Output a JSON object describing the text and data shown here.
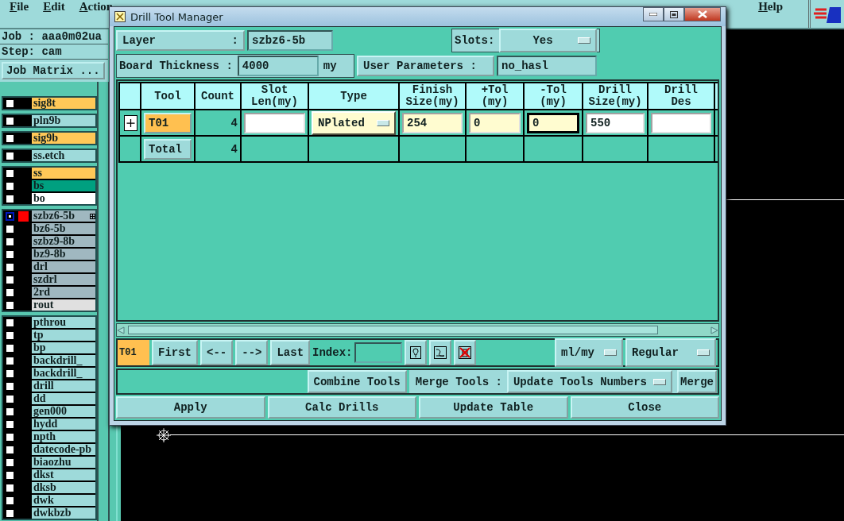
{
  "menu": [
    {
      "label": "File"
    },
    {
      "label": "Edit"
    },
    {
      "label": "Action"
    }
  ],
  "help": "Help",
  "job_info": {
    "job": "Job : aaa0m02ua",
    "step": "Step: cam",
    "matrix_button": "Job Matrix ..."
  },
  "layer_groups": [
    {
      "items": [
        {
          "name": "sig8t",
          "color": "#ffc858",
          "selected": false
        }
      ]
    },
    {
      "items": [
        {
          "name": "pln9b",
          "color": "#9edada",
          "selected": false
        }
      ]
    },
    {
      "items": [
        {
          "name": "sig9b",
          "color": "#ffc858",
          "selected": false
        }
      ]
    },
    {
      "items": [
        {
          "name": "ss.etch",
          "color": "#9edada",
          "selected": false
        }
      ]
    },
    {
      "items": [
        {
          "name": "ss",
          "color": "#ffc858",
          "selected": false
        },
        {
          "name": "bs",
          "color": "#00a080",
          "selected": false
        },
        {
          "name": "bo",
          "color": "#ffffff",
          "selected": false
        }
      ]
    },
    {
      "items": [
        {
          "name": "szbz6-5b",
          "color": "#a0b8c0",
          "selected": true
        },
        {
          "name": "bz6-5b",
          "color": "#a0b8c0",
          "selected": false
        },
        {
          "name": "szbz9-8b",
          "color": "#a0b8c0",
          "selected": false
        },
        {
          "name": "bz9-8b",
          "color": "#a0b8c0",
          "selected": false
        },
        {
          "name": "drl",
          "color": "#a0b8c0",
          "selected": false
        },
        {
          "name": "szdrl",
          "color": "#a0b8c0",
          "selected": false
        },
        {
          "name": "2rd",
          "color": "#a0b8c0",
          "selected": false
        },
        {
          "name": "rout",
          "color": "#e0e0e0",
          "selected": false
        }
      ]
    },
    {
      "items": [
        {
          "name": "pthrou",
          "color": "#9edada",
          "selected": false
        },
        {
          "name": "tp",
          "color": "#9edada",
          "selected": false
        },
        {
          "name": "bp",
          "color": "#9edada",
          "selected": false
        },
        {
          "name": "backdrill_",
          "color": "#9edada",
          "selected": false
        },
        {
          "name": "backdrill_",
          "color": "#9edada",
          "selected": false
        },
        {
          "name": "drill",
          "color": "#9edada",
          "selected": false
        },
        {
          "name": "dd",
          "color": "#9edada",
          "selected": false
        },
        {
          "name": "gen000",
          "color": "#9edada",
          "selected": false
        },
        {
          "name": "hydd",
          "color": "#9edada",
          "selected": false
        },
        {
          "name": "npth",
          "color": "#9edada",
          "selected": false
        },
        {
          "name": "datecode-pb",
          "color": "#9edada",
          "selected": false
        },
        {
          "name": "biaozhu",
          "color": "#9edada",
          "selected": false
        },
        {
          "name": "dkst",
          "color": "#9edada",
          "selected": false
        },
        {
          "name": "dksb",
          "color": "#9edada",
          "selected": false
        },
        {
          "name": "dwk",
          "color": "#9edada",
          "selected": false
        },
        {
          "name": "dwkbzb",
          "color": "#9edada",
          "selected": false
        }
      ]
    }
  ],
  "dialog": {
    "title": "Drill Tool Manager",
    "layer_label": "Layer",
    "layer_colon": ":",
    "layer_value": "szbz6-5b",
    "slots_label": "Slots:",
    "slots_value": "Yes",
    "thickness_label": "Board Thickness :",
    "thickness_value": "4000",
    "thickness_unit": "my",
    "user_params_label": "User Parameters :",
    "user_params_value": "no_hasl",
    "table": {
      "columns": [
        "Tool",
        "Count",
        "Slot\nLen(my)",
        "Type",
        "Finish\nSize(my)",
        "+Tol\n(my)",
        "-Tol\n(my)",
        "Drill\nSize(my)",
        "Drill\nDes"
      ],
      "rows": [
        {
          "expandable": true,
          "cells": [
            {
              "kind": "tool_button",
              "text": "T01",
              "highlighted": true
            },
            {
              "kind": "count",
              "text": "4"
            },
            {
              "kind": "field",
              "highlighted": false,
              "focused": false
            },
            {
              "kind": "dropdown",
              "value": "NPlated"
            },
            {
              "kind": "field",
              "value": "254",
              "highlighted": true,
              "focused": false
            },
            {
              "kind": "field",
              "value": "0",
              "highlighted": true,
              "focused": false
            },
            {
              "kind": "field",
              "value": "0",
              "highlighted": true,
              "focused": true
            },
            {
              "kind": "field",
              "value": "550",
              "highlighted": false,
              "focused": false
            },
            {
              "kind": "field",
              "highlighted": false,
              "focused": false
            }
          ]
        },
        {
          "expandable": false,
          "cells": [
            {
              "kind": "tool_button",
              "text": "Total",
              "highlighted": false
            },
            {
              "kind": "count",
              "text": "4"
            }
          ]
        }
      ]
    },
    "nav": {
      "current_tool": "T01",
      "buttons": [
        "First",
        "<--",
        "-->",
        "Last"
      ],
      "index_label": "Index:",
      "units": "ml/my",
      "mode": "Regular"
    },
    "combine": "Combine Tools",
    "merge_label": "Merge Tools :",
    "merge_option": "Update Tools Numbers",
    "merge_button": "Merge",
    "actions": [
      "Apply",
      "Calc Drills",
      "Update Table",
      "Close"
    ]
  }
}
